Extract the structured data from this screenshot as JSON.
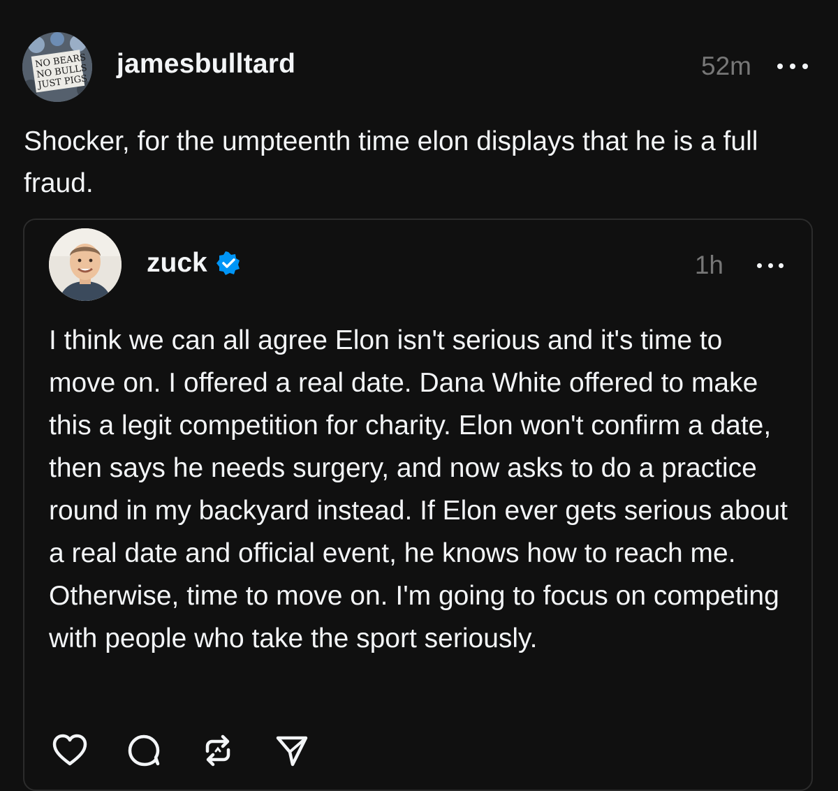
{
  "post": {
    "username": "jamesbulltard",
    "time": "52m",
    "text": "Shocker, for the umpteenth time elon displays that he is a full fraud.",
    "avatar_sign_text": [
      "NO BEARS",
      "NO BULLS",
      "JUST PIGS"
    ]
  },
  "quote": {
    "username": "zuck",
    "verified": true,
    "time": "1h",
    "text": "I think we can all agree Elon isn't serious and it's time to move on. I offered a real date. Dana White offered to make this a legit competition for charity. Elon won't confirm a date, then says he needs surgery, and now asks to do a practice round in my backyard instead. If Elon ever gets serious about a real date and official event, he knows how to reach me. Otherwise, time to move on. I'm going to focus on competing with people who take the sport seriously."
  },
  "actions": [
    {
      "icon": "heart-icon"
    },
    {
      "icon": "comment-icon"
    },
    {
      "icon": "repost-icon"
    },
    {
      "icon": "share-icon"
    }
  ],
  "colors": {
    "background": "#101010",
    "text": "#f3f5f7",
    "muted": "#777777",
    "border": "#2c2c2c",
    "verified": "#0095f6"
  }
}
